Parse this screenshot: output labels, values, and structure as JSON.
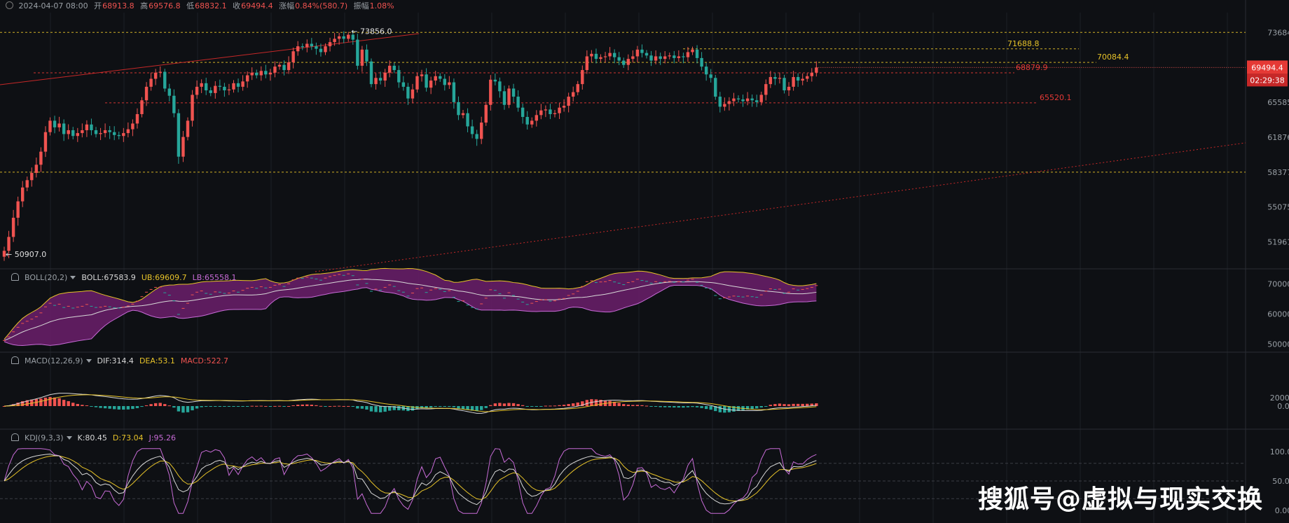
{
  "header": {
    "datetime": "2024-04-07 08:00",
    "open_label": "开",
    "open": "68913.8",
    "high_label": "高",
    "high": "69576.8",
    "low_label": "低",
    "low": "68832.1",
    "close_label": "收",
    "close": "69494.4",
    "change_label": "涨幅",
    "change": "0.84%(580.7)",
    "amplitude_label": "振幅",
    "amplitude": "1.08%"
  },
  "indicators": {
    "boll": {
      "name": "BOLL(20,2)",
      "mid": "BOLL:67583.9",
      "ub": "UB:69609.7",
      "lb": "LB:65558.1"
    },
    "macd": {
      "name": "MACD(12,26,9)",
      "dif": "DIF:314.4",
      "dea": "DEA:53.1",
      "macd": "MACD:522.7"
    },
    "kdj": {
      "name": "KDJ(9,3,3)",
      "k": "K:80.45",
      "d": "D:73.04",
      "j": "J:95.26"
    }
  },
  "watermark": "搜狐号@虚拟与现实交换",
  "colors": {
    "up": "#f05350",
    "down": "#26a69a",
    "level": "#e6c229",
    "support": "#e53935"
  },
  "chart_data": {
    "type": "candlestick",
    "price_axis": {
      "ticks": [
        "73684.2",
        "69494.4",
        "65585.6",
        "61876.5",
        "58377.2",
        "55075.7",
        "51961.0"
      ],
      "tick_values": [
        73684.2,
        69494.4,
        65585.6,
        61876.5,
        58377.2,
        55075.7,
        51961.0
      ],
      "current_price": "69494.4",
      "countdown": "02:29:38",
      "ylim": [
        49800,
        75800
      ]
    },
    "annotations": {
      "high_marker": "73856.0",
      "low_marker": "50907.0",
      "level_1": "71688.8",
      "level_2": "70084.4",
      "level_3": "68879.9",
      "level_4": "65520.1"
    },
    "horizontal_levels": [
      73684.2,
      71688.8,
      70084.4,
      68879.9,
      65520.1,
      58377.2
    ],
    "close_series": [
      51200,
      52400,
      54100,
      55600,
      56900,
      57600,
      58300,
      59100,
      60400,
      62400,
      63600,
      62900,
      63300,
      62200,
      62600,
      62000,
      62300,
      62600,
      63200,
      62600,
      62200,
      62300,
      62600,
      62400,
      62100,
      62000,
      62300,
      62700,
      63300,
      64300,
      65800,
      67300,
      68200,
      68900,
      69000,
      67100,
      66300,
      64400,
      59900,
      61900,
      63600,
      66400,
      67300,
      67700,
      66900,
      66600,
      67400,
      67300,
      66900,
      67000,
      67700,
      67300,
      67900,
      68600,
      68900,
      68600,
      69100,
      68700,
      68900,
      69600,
      69800,
      69200,
      70100,
      71400,
      72000,
      71900,
      72300,
      72000,
      71700,
      71300,
      72000,
      72500,
      72900,
      73200,
      72900,
      73400,
      72800,
      69700,
      71600,
      70200,
      67600,
      68300,
      68000,
      68900,
      69700,
      69200,
      67800,
      67300,
      66000,
      67000,
      68500,
      68700,
      67200,
      68000,
      68500,
      68200,
      67500,
      67800,
      65600,
      64200,
      64400,
      63000,
      62200,
      61700,
      63400,
      65300,
      68100,
      67900,
      66800,
      65300,
      67100,
      66200,
      65000,
      64000,
      63200,
      63600,
      64200,
      64700,
      64800,
      64300,
      64400,
      65000,
      65200,
      66200,
      66700,
      67600,
      69200,
      70800,
      71100,
      70500,
      70700,
      70800,
      71200,
      70700,
      70300,
      69800,
      70500,
      70800,
      71600,
      71200,
      70900,
      70300,
      70800,
      70500,
      70800,
      70900,
      70600,
      70800,
      70700,
      71300,
      71600,
      70600,
      69600,
      68700,
      68300,
      66200,
      65100,
      65400,
      65700,
      66000,
      65900,
      65700,
      66000,
      65800,
      65600,
      66400,
      67600,
      68400,
      68200,
      68300,
      66900,
      67300,
      68400,
      68000,
      68200,
      68500,
      68900,
      69500
    ],
    "boll_axis": {
      "ticks": [
        "70000.0",
        "60000.0",
        "50000.0"
      ],
      "tick_values": [
        70000,
        60000,
        50000
      ]
    },
    "macd_axis": {
      "ticks": [
        "2000.0",
        "0.0"
      ],
      "tick_values": [
        2000,
        0
      ]
    },
    "kdj_axis": {
      "ticks": [
        "100.00",
        "50.00",
        "0.00"
      ],
      "tick_values": [
        100,
        50,
        0
      ]
    }
  }
}
